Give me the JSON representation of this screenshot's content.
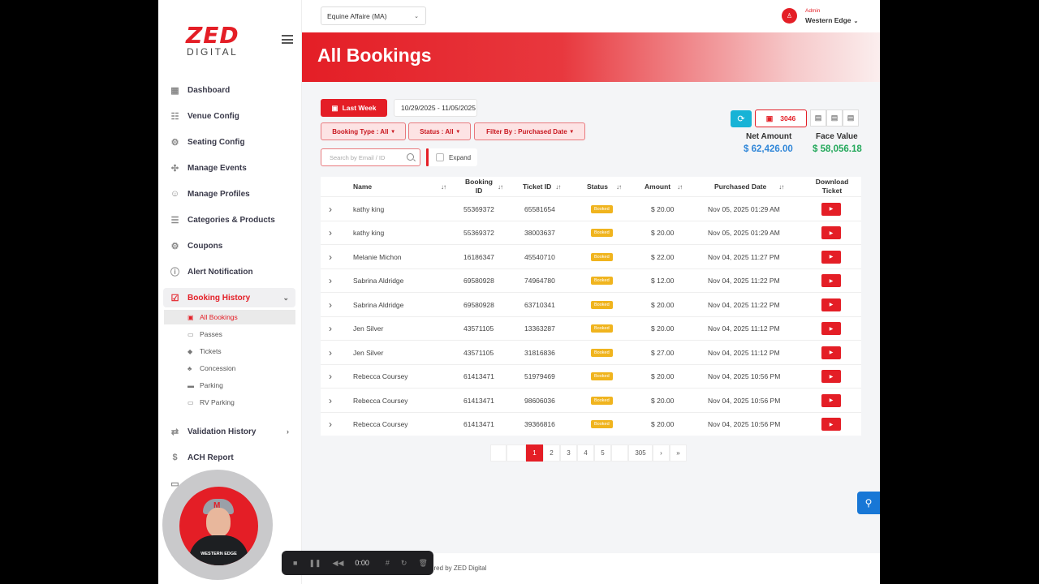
{
  "brand": {
    "line1": "ZED",
    "line2": "DIGITAL"
  },
  "topbar": {
    "venue": "Equine Affaire (MA)",
    "user_role": "Admin",
    "user_name": "Western Edge"
  },
  "sidebar": {
    "items": [
      {
        "label": "Dashboard",
        "icon": "grid-icon"
      },
      {
        "label": "Venue Config",
        "icon": "list-icon"
      },
      {
        "label": "Seating Config",
        "icon": "gear-icon"
      },
      {
        "label": "Manage Events",
        "icon": "nodes-icon"
      },
      {
        "label": "Manage Profiles",
        "icon": "user-gear-icon"
      },
      {
        "label": "Categories & Products",
        "icon": "list-plus-icon"
      },
      {
        "label": "Coupons",
        "icon": "gear-icon"
      },
      {
        "label": "Alert Notification",
        "icon": "alert-icon"
      },
      {
        "label": "Booking History",
        "icon": "calendar-check-icon"
      },
      {
        "label": "Validation History",
        "icon": "arrows-icon"
      },
      {
        "label": "ACH Report",
        "icon": "dollar-icon"
      }
    ],
    "sub_items": [
      {
        "label": "All Bookings"
      },
      {
        "label": "Passes"
      },
      {
        "label": "Tickets"
      },
      {
        "label": "Concession"
      },
      {
        "label": "Parking"
      },
      {
        "label": "RV Parking"
      }
    ]
  },
  "banner": {
    "title": "All Bookings"
  },
  "filters": {
    "last_week": "Last Week",
    "date_range": "10/29/2025 - 11/05/2025",
    "booking_type": "Booking Type : All",
    "status": "Status : All",
    "filter_by": "Filter By : Purchased Date",
    "search_placeholder": "Search by Email / ID",
    "expand": "Expand"
  },
  "summary": {
    "count": "3046",
    "net_amount_label": "Net Amount",
    "net_amount": "$ 62,426.00",
    "face_value_label": "Face Value",
    "face_value": "$ 58,056.18",
    "net_color": "#2f86d8",
    "face_color": "#22a85a"
  },
  "table": {
    "headers": {
      "name": "Name",
      "booking_id_1": "Booking",
      "booking_id_2": "ID",
      "ticket_id": "Ticket ID",
      "status": "Status",
      "amount": "Amount",
      "purchased_date": "Purchased Date",
      "download_1": "Download",
      "download_2": "Ticket",
      "sort": "↓↑"
    },
    "rows": [
      {
        "name": "kathy king",
        "booking_id": "55369372",
        "ticket_id": "65581654",
        "status": "Booked",
        "amount": "$ 20.00",
        "date": "Nov 05, 2025 01:29 AM"
      },
      {
        "name": "kathy king",
        "booking_id": "55369372",
        "ticket_id": "38003637",
        "status": "Booked",
        "amount": "$ 20.00",
        "date": "Nov 05, 2025 01:29 AM"
      },
      {
        "name": "Melanie Michon",
        "booking_id": "16186347",
        "ticket_id": "45540710",
        "status": "Booked",
        "amount": "$ 22.00",
        "date": "Nov 04, 2025 11:27 PM"
      },
      {
        "name": "Sabrina Aldridge",
        "booking_id": "69580928",
        "ticket_id": "74964780",
        "status": "Booked",
        "amount": "$ 12.00",
        "date": "Nov 04, 2025 11:22 PM"
      },
      {
        "name": "Sabrina Aldridge",
        "booking_id": "69580928",
        "ticket_id": "63710341",
        "status": "Booked",
        "amount": "$ 20.00",
        "date": "Nov 04, 2025 11:22 PM"
      },
      {
        "name": "Jen Silver",
        "booking_id": "43571105",
        "ticket_id": "13363287",
        "status": "Booked",
        "amount": "$ 20.00",
        "date": "Nov 04, 2025 11:12 PM"
      },
      {
        "name": "Jen Silver",
        "booking_id": "43571105",
        "ticket_id": "31816836",
        "status": "Booked",
        "amount": "$ 27.00",
        "date": "Nov 04, 2025 11:12 PM"
      },
      {
        "name": "Rebecca Coursey",
        "booking_id": "61413471",
        "ticket_id": "51979469",
        "status": "Booked",
        "amount": "$ 20.00",
        "date": "Nov 04, 2025 10:56 PM"
      },
      {
        "name": "Rebecca Coursey",
        "booking_id": "61413471",
        "ticket_id": "98606036",
        "status": "Booked",
        "amount": "$ 20.00",
        "date": "Nov 04, 2025 10:56 PM"
      },
      {
        "name": "Rebecca Coursey",
        "booking_id": "61413471",
        "ticket_id": "39366816",
        "status": "Booked",
        "amount": "$ 20.00",
        "date": "Nov 04, 2025 10:56 PM"
      }
    ]
  },
  "pagination": {
    "pages": [
      "1",
      "2",
      "3",
      "4",
      "5"
    ],
    "last": "305",
    "next": "›",
    "end": "»",
    "current": "1"
  },
  "footer": {
    "text": "ered by ZED Digital"
  },
  "overlay": {
    "jersey": "WESTERN EDGE",
    "cap_letter": "M",
    "timer": "0:00"
  }
}
